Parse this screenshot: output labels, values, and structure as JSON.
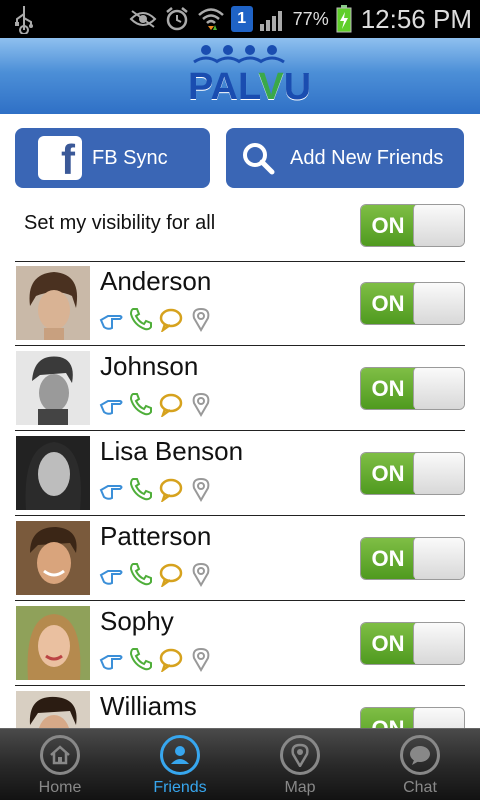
{
  "status_bar": {
    "battery_percent": "77%",
    "time": "12:56 PM",
    "badge": "1",
    "icons": [
      "usb-icon",
      "eye-icon",
      "alarm-icon",
      "wifi-icon",
      "signal-icon",
      "battery-icon"
    ]
  },
  "header": {
    "logo_text_a": "PAL",
    "logo_text_b": "V",
    "logo_text_c": "U"
  },
  "buttons": {
    "fb_sync": "FB Sync",
    "add_friends": "Add New Friends"
  },
  "visibility": {
    "label": "Set my visibility for all",
    "toggle": "ON"
  },
  "friends": [
    {
      "name": "Anderson",
      "toggle": "ON"
    },
    {
      "name": "Johnson",
      "toggle": "ON"
    },
    {
      "name": "Lisa Benson",
      "toggle": "ON"
    },
    {
      "name": "Patterson",
      "toggle": "ON"
    },
    {
      "name": "Sophy",
      "toggle": "ON"
    },
    {
      "name": "Williams",
      "toggle": "ON"
    }
  ],
  "nav": [
    {
      "label": "Home",
      "icon": "home-icon"
    },
    {
      "label": "Friends",
      "icon": "friends-icon",
      "active": true
    },
    {
      "label": "Map",
      "icon": "map-pin-icon"
    },
    {
      "label": "Chat",
      "icon": "chat-icon"
    }
  ],
  "colors": {
    "accent": "#37a6ee",
    "button_blue": "#3a66b5",
    "toggle_green": "#5fa82c"
  }
}
